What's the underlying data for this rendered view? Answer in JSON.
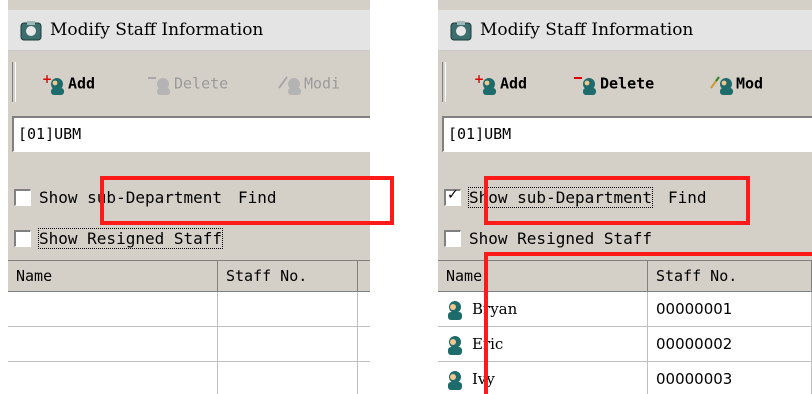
{
  "left_panel": {
    "title": "Modify Staff Information",
    "toolbar": {
      "add": "Add",
      "delete": "Delete",
      "modify": "Modi"
    },
    "department": "[01]UBM",
    "show_sub_department": {
      "label": "Show sub-Department",
      "checked": false
    },
    "find_label": "Find",
    "show_resigned": {
      "label": "Show Resigned Staff",
      "checked": false
    },
    "grid": {
      "headers": {
        "name": "Name",
        "staff_no": "Staff No."
      },
      "rows": []
    }
  },
  "right_panel": {
    "title": "Modify Staff Information",
    "toolbar": {
      "add": "Add",
      "delete": "Delete",
      "modify": "Mod"
    },
    "department": "[01]UBM",
    "show_sub_department": {
      "label": "Show sub-Department",
      "checked": true
    },
    "find_label": "Find",
    "show_resigned": {
      "label": "Show Resigned Staff",
      "checked": false
    },
    "grid": {
      "headers": {
        "name": "Name",
        "staff_no": "Staff No."
      },
      "rows": [
        {
          "name": "Bryan",
          "staff_no": "00000001"
        },
        {
          "name": "Eric",
          "staff_no": "00000002"
        },
        {
          "name": "Ivy",
          "staff_no": "00000003"
        }
      ]
    }
  },
  "colors": {
    "highlight": "#ff1a1a",
    "face": "#d4d0c8"
  }
}
